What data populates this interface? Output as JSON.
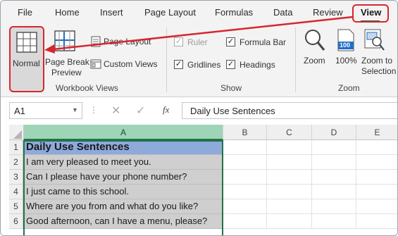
{
  "tabs": [
    {
      "label": "File",
      "active": false
    },
    {
      "label": "Home",
      "active": false
    },
    {
      "label": "Insert",
      "active": false
    },
    {
      "label": "Page Layout",
      "active": false
    },
    {
      "label": "Formulas",
      "active": false
    },
    {
      "label": "Data",
      "active": false
    },
    {
      "label": "Review",
      "active": false
    },
    {
      "label": "View",
      "active": true
    }
  ],
  "ribbon": {
    "workbook_views": {
      "normal": "Normal",
      "page_break_line1": "Page Break",
      "page_break_line2": "Preview",
      "page_layout": "Page Layout",
      "custom_views": "Custom Views",
      "group_label": "Workbook Views"
    },
    "show": {
      "ruler": "Ruler",
      "formula_bar": "Formula Bar",
      "gridlines": "Gridlines",
      "headings": "Headings",
      "ruler_checked": true,
      "formula_bar_checked": true,
      "gridlines_checked": true,
      "headings_checked": true,
      "group_label": "Show"
    },
    "zoom": {
      "zoom": "Zoom",
      "hundred": "100%",
      "hundred_badge": "100",
      "zoom_to_line1": "Zoom to",
      "zoom_to_line2": "Selection",
      "group_label": "Zoom"
    }
  },
  "formula_bar": {
    "name_box": "A1",
    "fx": "fx",
    "content": "Daily Use Sentences"
  },
  "grid": {
    "columns": [
      "A",
      "B",
      "C",
      "D",
      "E"
    ],
    "rows": [
      {
        "num": "1",
        "a": "Daily Use Sentences"
      },
      {
        "num": "2",
        "a": "I am very pleased to meet you."
      },
      {
        "num": "3",
        "a": "Can I please have your phone number?"
      },
      {
        "num": "4",
        "a": "I just came to this school."
      },
      {
        "num": "5",
        "a": "Where are you from and what do you like?"
      },
      {
        "num": "6",
        "a": "Good afternoon, can I have a menu, please?"
      }
    ]
  },
  "colors": {
    "accent_green": "#217346",
    "highlight_red": "#d7262f",
    "header_blue": "#8eaadb",
    "zoom_blue": "#1f6fc5"
  },
  "icons": [
    "normal-view-icon",
    "page-break-preview-icon",
    "page-layout-icon",
    "custom-views-icon",
    "zoom-magnifier-icon",
    "hundred-percent-icon",
    "zoom-to-selection-icon",
    "cancel-icon",
    "enter-icon",
    "name-box-dropdown-icon",
    "select-all-icon"
  ]
}
